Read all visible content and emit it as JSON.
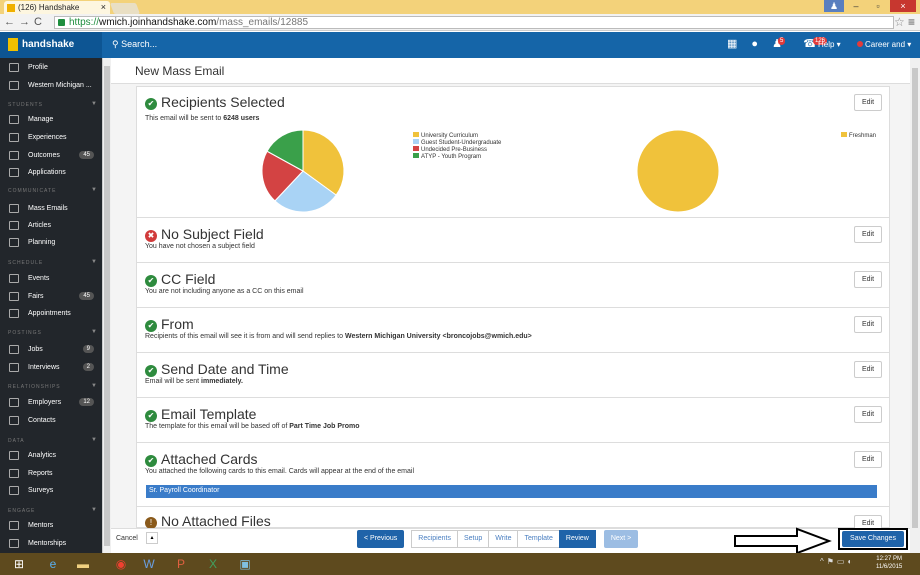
{
  "browser": {
    "tab_title": "(126) Handshake",
    "url_https": "https://",
    "url_host": "wmich.joinhandshake.com",
    "url_path": "/mass_emails/12885",
    "nav_glyphs": "←→C"
  },
  "appbar": {
    "brand": "handshake",
    "search_placeholder": "Search...",
    "notif_badge_1": "5",
    "notif_badge_2": "126",
    "help_label": "Help ▾",
    "career_label": "Career and ▾"
  },
  "sidebar": {
    "profile": "Profile",
    "school": "Western Michigan ...",
    "students_head": "STUDENTS",
    "manage": "Manage",
    "experiences": "Experiences",
    "outcomes": "Outcomes",
    "outcomes_count": "45",
    "applications": "Applications",
    "communicate_head": "COMMUNICATE",
    "mass_emails": "Mass Emails",
    "articles": "Articles",
    "planning": "Planning",
    "schedule_head": "SCHEDULE",
    "events": "Events",
    "fairs": "Fairs",
    "fairs_count": "45",
    "appointments": "Appointments",
    "postings_head": "POSTINGS",
    "jobs": "Jobs",
    "jobs_count": "9",
    "interviews": "Interviews",
    "interviews_count": "2",
    "relationships_head": "RELATIONSHIPS",
    "employers": "Employers",
    "employers_count": "12",
    "contacts": "Contacts",
    "data_head": "DATA",
    "analytics": "Analytics",
    "reports": "Reports",
    "surveys": "Surveys",
    "engage_head": "ENGAGE",
    "mentors": "Mentors",
    "mentorships": "Mentorships"
  },
  "page": {
    "title": "New Mass Email",
    "edit_label": "Edit"
  },
  "sections": {
    "recipients": {
      "title": "Recipients Selected",
      "desc_pre": "This email will be sent to ",
      "desc_bold": "6248 users"
    },
    "subject": {
      "title": "No Subject Field",
      "desc": "You have not chosen a subject field"
    },
    "cc": {
      "title": "CC Field",
      "desc": "You are not including anyone as a CC on this email"
    },
    "from": {
      "title": "From",
      "desc_pre": "Recipients of this email will see it is from and will send replies to ",
      "desc_bold": "Western Michigan University <broncojobs@wmich.edu>"
    },
    "send": {
      "title": "Send Date and Time",
      "desc_pre": "Email will be sent ",
      "desc_bold": "immediately."
    },
    "template": {
      "title": "Email Template",
      "desc_pre": "The template for this email will be based off of ",
      "desc_bold": "Part Time Job Promo"
    },
    "cards": {
      "title": "Attached Cards",
      "desc": "You attached the following cards to this email. Cards will appear at the end of the email",
      "card_item": "Sr. Payroll Coordinator"
    },
    "files": {
      "title": "No Attached Files"
    }
  },
  "chart_data": [
    {
      "type": "pie",
      "labels": [
        "University Curriculum",
        "Guest Student-Undergraduate",
        "Undecided Pre-Business",
        "ATYP - Youth Program"
      ],
      "values": [
        35,
        27,
        21,
        17
      ],
      "colors": [
        "#f0c23b",
        "#a9d3f5",
        "#d34343",
        "#3aa04a"
      ]
    },
    {
      "type": "pie",
      "labels": [
        "Freshman"
      ],
      "values": [
        100
      ],
      "colors": [
        "#f0c23b"
      ]
    }
  ],
  "footer": {
    "cancel": "Cancel",
    "cancel_arrow": "▴",
    "previous": "< Previous",
    "steps": [
      "Recipients",
      "Setup",
      "Write",
      "Template",
      "Review"
    ],
    "next": "Next >",
    "save": "Save Changes"
  },
  "taskbar": {
    "time": "12:27 PM",
    "date": "11/6/2015"
  }
}
